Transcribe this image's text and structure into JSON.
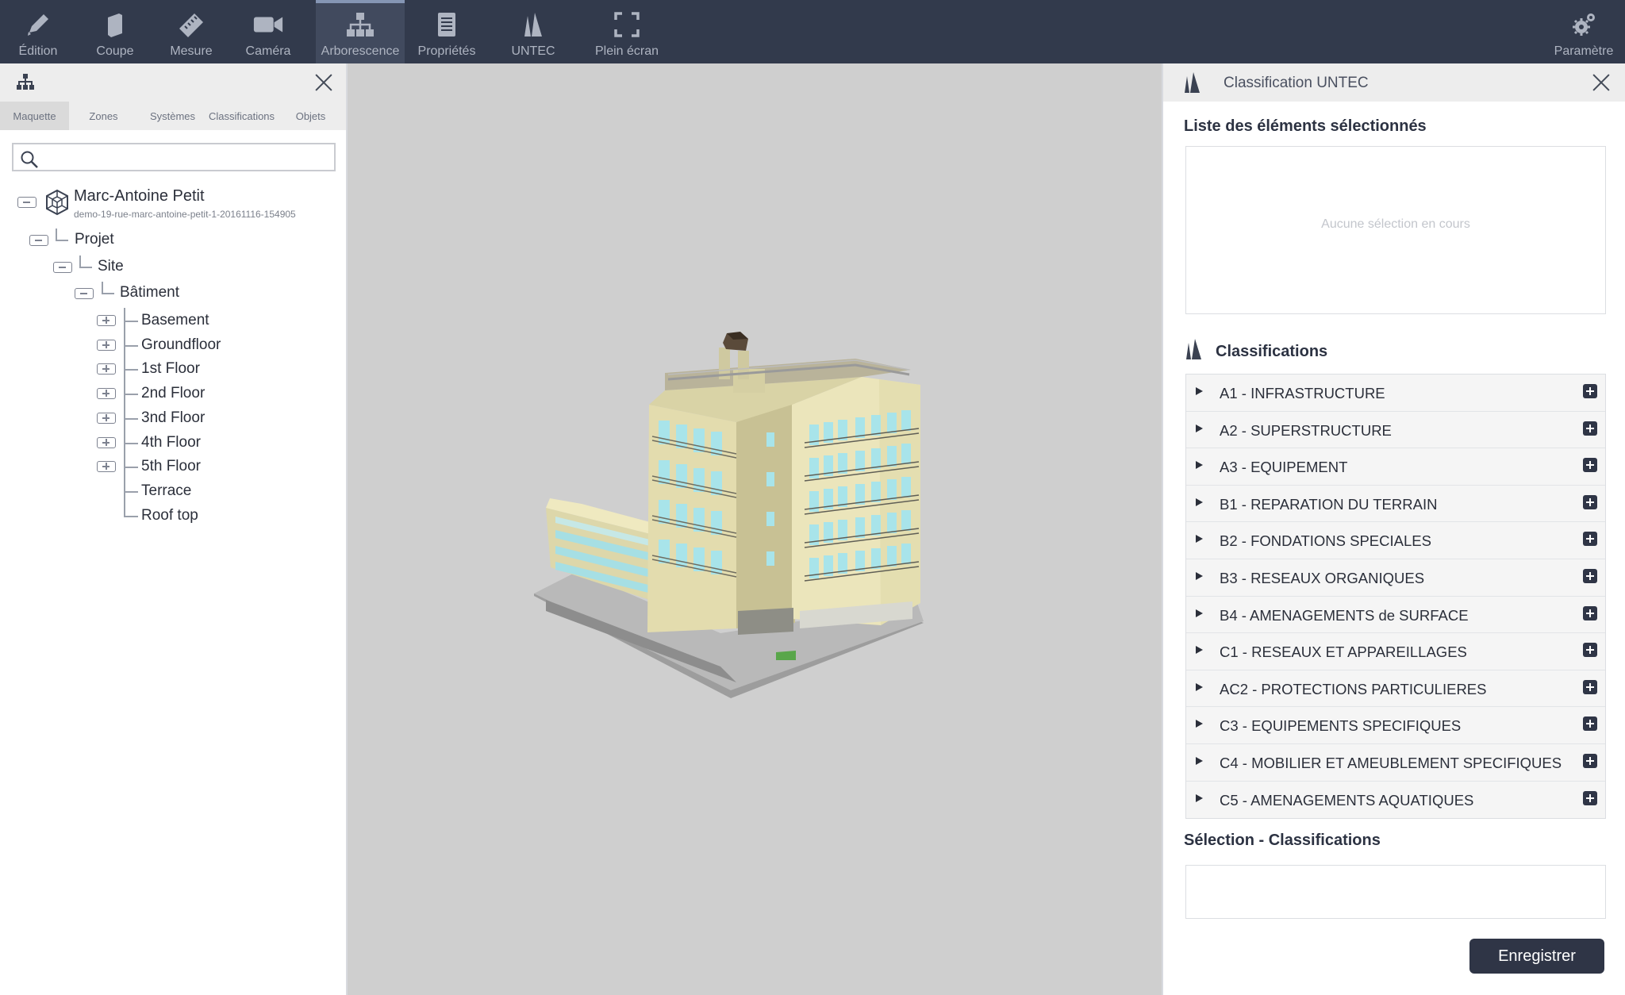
{
  "toolbar": {
    "items": [
      {
        "label": "Édition",
        "icon": "pencil-icon"
      },
      {
        "label": "Coupe",
        "icon": "section-cut-icon"
      },
      {
        "label": "Mesure",
        "icon": "ruler-icon"
      },
      {
        "label": "Caméra",
        "icon": "video-camera-icon"
      },
      {
        "label": "Arborescence",
        "icon": "tree-hierarchy-icon",
        "active": true
      },
      {
        "label": "Propriétés",
        "icon": "document-list-icon"
      },
      {
        "label": "UNTEC",
        "icon": "untec-logo-icon"
      },
      {
        "label": "Plein écran",
        "icon": "fullscreen-icon"
      }
    ],
    "settings_label": "Paramètre"
  },
  "left_panel": {
    "tabs": [
      "Maquette",
      "Zones",
      "Systèmes",
      "Classifications",
      "Objets"
    ],
    "active_tab": "Maquette",
    "search": {
      "value": "",
      "placeholder": ""
    },
    "tree": {
      "root_name": "Marc-Antoine Petit",
      "root_id": "demo-19-rue-marc-antoine-petit-1-20161116-154905",
      "project": "Projet",
      "site": "Site",
      "building": "Bâtiment",
      "levels": [
        {
          "name": "Basement",
          "collapsed": true
        },
        {
          "name": "Groundfloor",
          "collapsed": true
        },
        {
          "name": "1st Floor",
          "collapsed": true
        },
        {
          "name": "2nd Floor",
          "collapsed": true
        },
        {
          "name": "3nd Floor",
          "collapsed": true
        },
        {
          "name": "4th Floor",
          "collapsed": true
        },
        {
          "name": "5th Floor",
          "collapsed": true
        },
        {
          "name": "Terrace",
          "collapsed": null
        },
        {
          "name": "Roof top",
          "collapsed": null
        }
      ]
    }
  },
  "right_panel": {
    "title": "Classification UNTEC",
    "selected_list_title": "Liste des éléments sélectionnés",
    "empty_selection": "Aucune sélection en cours",
    "classifications_title": "Classifications",
    "classifications": [
      "A1 - INFRASTRUCTURE",
      "A2 - SUPERSTRUCTURE",
      "A3 - EQUIPEMENT",
      "B1 - REPARATION DU TERRAIN",
      "B2 - FONDATIONS SPECIALES",
      "B3 - RESEAUX ORGANIQUES",
      "B4 - AMENAGEMENTS de SURFACE",
      "C1 - RESEAUX ET APPAREILLAGES",
      "AC2 - PROTECTIONS PARTICULIERES",
      "C3 - EQUIPEMENTS SPECIFIQUES",
      "C4 - MOBILIER ET AMEUBLEMENT SPECIFIQUES",
      "C5 - AMENAGEMENTS AQUATIQUES"
    ],
    "selection_classifications_title": "Sélection - Classifications",
    "save_label": "Enregistrer"
  },
  "colors": {
    "toolbar_bg": "#323a4c",
    "toolbar_active": "#414a5e",
    "viewer_bg": "#cfcfcf",
    "button_dark": "#2f3546",
    "building_facade": "#e8e3b8",
    "window_glass": "#a8e4ea"
  }
}
